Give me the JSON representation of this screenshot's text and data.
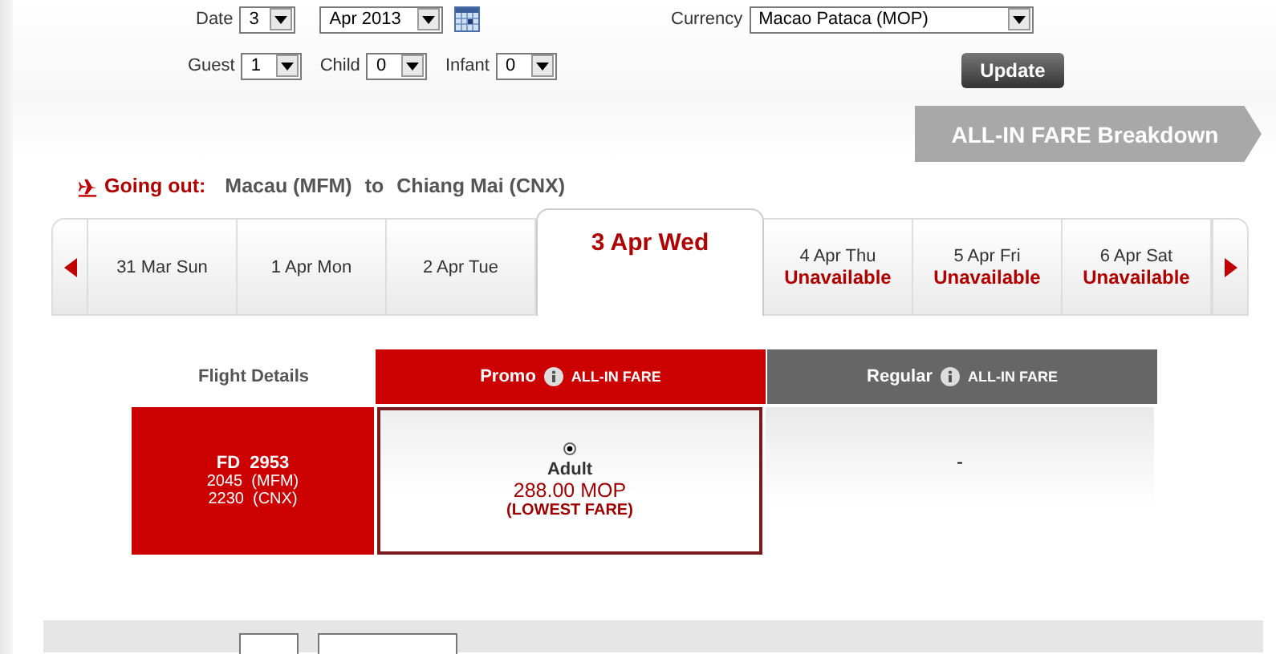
{
  "search_form": {
    "date_label": "Date",
    "day": "3",
    "month": "Apr 2013",
    "currency_label": "Currency",
    "currency": "Macao Pataca (MOP)",
    "guest_label": "Guest",
    "guest": "1",
    "child_label": "Child",
    "child": "0",
    "infant_label": "Infant",
    "infant": "0",
    "update_button": "Update"
  },
  "fare_breakdown_button": "ALL-IN FARE Breakdown",
  "route": {
    "label": "Going out:",
    "origin": "Macau (MFM)",
    "connector": "to",
    "destination": "Chiang Mai (CNX)"
  },
  "date_tabs": [
    {
      "date": "31 Mar Sun",
      "selected": false
    },
    {
      "date": "1 Apr Mon",
      "selected": false
    },
    {
      "date": "2 Apr Tue",
      "selected": false
    },
    {
      "date": "3 Apr Wed",
      "selected": true
    },
    {
      "date": "4 Apr Thu",
      "status": "Unavailable",
      "selected": false
    },
    {
      "date": "5 Apr Fri",
      "status": "Unavailable",
      "selected": false
    },
    {
      "date": "6 Apr Sat",
      "status": "Unavailable",
      "selected": false
    }
  ],
  "fare_table": {
    "columns": [
      {
        "label": "Flight Details",
        "kind": "plain"
      },
      {
        "label": "Promo",
        "tag": "ALL-IN FARE",
        "kind": "promo"
      },
      {
        "label": "Regular",
        "tag": "ALL-IN FARE",
        "kind": "regular"
      }
    ],
    "rows": [
      {
        "flight": "FD  2953",
        "departure": "2045  (MFM)",
        "arrival": "2230  (CNX)",
        "promo": {
          "selected": true,
          "passenger": "Adult",
          "price": "288.00 MOP",
          "note": "(LOWEST FARE)"
        },
        "regular": "-"
      }
    ]
  }
}
